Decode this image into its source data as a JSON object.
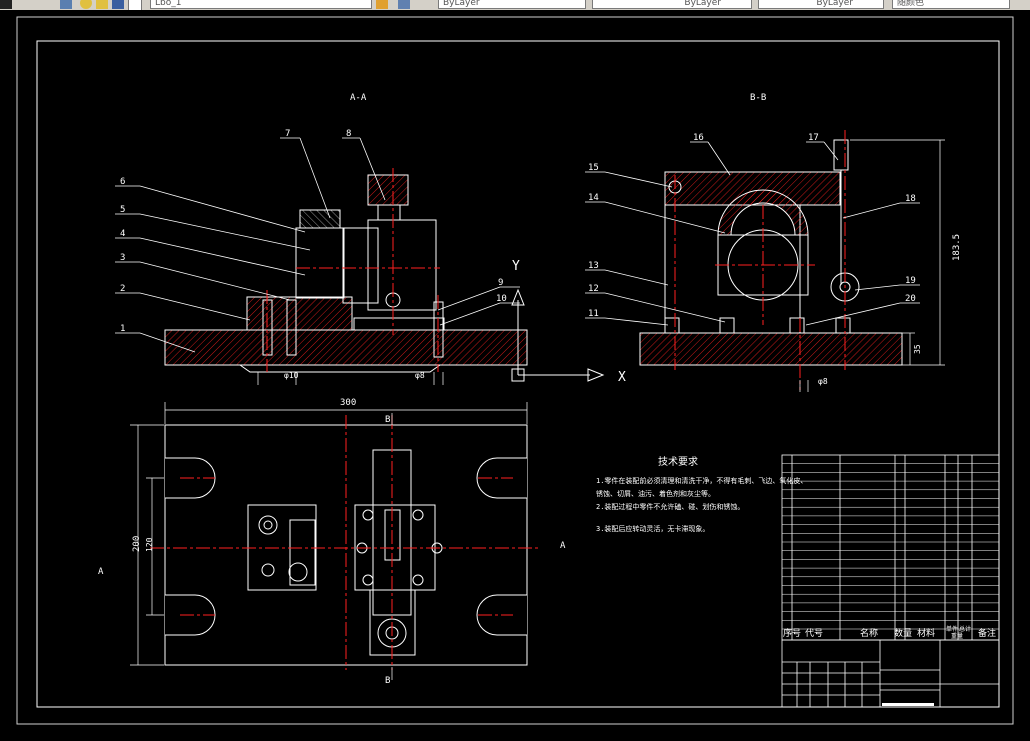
{
  "toolbar": {
    "layer_value": "Lbo_1",
    "color_value": "ByLayer",
    "linetype_value": "ByLayer",
    "lineweight_value": "ByLayer",
    "plotstyle_value": "随颜色"
  },
  "colors": {
    "background": "#000000",
    "white": "#ffffff",
    "red": "#ff2020",
    "yellow": "#ffff00",
    "green": "#00c000",
    "toolbar": "#d4d0c8"
  },
  "drawing": {
    "section_aa": "A-A",
    "section_bb": "B-B",
    "section_a_marker": "A",
    "section_b_marker": "B",
    "callouts_aa": [
      "1",
      "2",
      "3",
      "4",
      "5",
      "6",
      "7",
      "8",
      "9",
      "10"
    ],
    "callouts_bb": [
      "11",
      "12",
      "13",
      "14",
      "15",
      "16",
      "17",
      "18",
      "19",
      "20"
    ],
    "dim_width": "300",
    "dim_height": "200",
    "dim_height_inner": "120",
    "dim_bb_height": "183.5",
    "dim_bb_base": "35",
    "dim_phi_left": "φ10",
    "dim_phi_mid": "φ8",
    "dim_phi_bb": "φ8",
    "ucs_y": "Y",
    "ucs_x": "X",
    "tech_title": "技术要求",
    "tech_lines": [
      "1.零件在装配前必须清理和清洗干净，不得有毛刺、飞边、氧化皮、",
      "锈蚀、切屑、油污、着色剂和灰尘等。",
      "2.装配过程中零件不允许磕、碰、划伤和锈蚀。",
      "3.装配后应转动灵活，无卡滞现象。"
    ],
    "bom_headers": [
      "序号",
      "代号",
      "名称",
      "数量",
      "材料",
      "单件",
      "总计",
      "备注"
    ],
    "bom_weight_header": "重量"
  }
}
